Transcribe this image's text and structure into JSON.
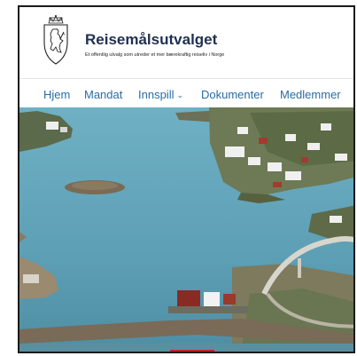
{
  "site": {
    "title": "Reisemålsutvalget",
    "subtitle": "Et offentlig utvalg som utreder et mer bærekraftig reiseliv i Norge",
    "logo_icon": "norwegian-coat-of-arms-icon"
  },
  "nav": {
    "items": [
      {
        "label": "Hjem"
      },
      {
        "label": "Mandat"
      },
      {
        "label": "Innspill",
        "has_dropdown": true,
        "dropdown_icon": "chevron-down-icon"
      },
      {
        "label": "Dokumenter"
      },
      {
        "label": "Medlemmer"
      }
    ]
  },
  "hero": {
    "image": "aerial-coastal-village-with-bridges"
  },
  "colors": {
    "title": "#1f3050",
    "nav_link": "#2a6ca3",
    "accent_red": "#c8202a",
    "sea": "#5d9fb5"
  }
}
